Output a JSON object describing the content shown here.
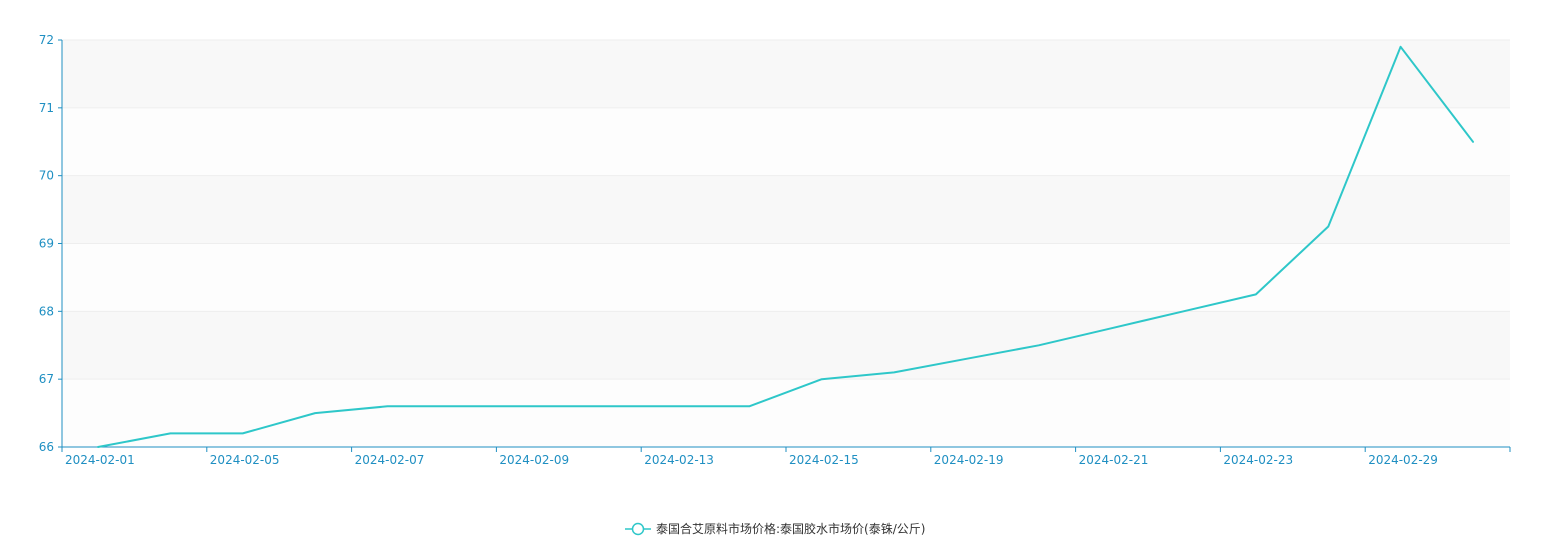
{
  "chart_data": {
    "type": "line",
    "title": "",
    "xlabel": "",
    "ylabel": "",
    "ylim": [
      66,
      72
    ],
    "y_ticks": [
      66,
      67,
      68,
      69,
      70,
      71,
      72
    ],
    "x_tick_labels": [
      "2024-02-01",
      "2024-02-05",
      "2024-02-07",
      "2024-02-09",
      "2024-02-13",
      "2024-02-15",
      "2024-02-19",
      "2024-02-21",
      "2024-02-23",
      "2024-02-29"
    ],
    "grid": "horizontal bands",
    "legend_position": "bottom-center",
    "colors": {
      "line": "#2ec7c9",
      "axis": "#1f8fc2",
      "band": "#f8f8f8",
      "grid": "#eeeeee"
    },
    "series": [
      {
        "name": "泰国合艾原料市场价格:泰国胶水市场价(泰铢/公斤)",
        "points": [
          {
            "x": "2024-02-01",
            "y": 66.0
          },
          {
            "x": "2024-02-02",
            "y": 66.2
          },
          {
            "x": "2024-02-05",
            "y": 66.2
          },
          {
            "x": "2024-02-06",
            "y": 66.5
          },
          {
            "x": "2024-02-07",
            "y": 66.6
          },
          {
            "x": "2024-02-08",
            "y": 66.6
          },
          {
            "x": "2024-02-09",
            "y": 66.6
          },
          {
            "x": "2024-02-12",
            "y": 66.6
          },
          {
            "x": "2024-02-13",
            "y": 66.6
          },
          {
            "x": "2024-02-14",
            "y": 66.6
          },
          {
            "x": "2024-02-15",
            "y": 67.0
          },
          {
            "x": "2024-02-16",
            "y": 67.1
          },
          {
            "x": "2024-02-19",
            "y": 67.3
          },
          {
            "x": "2024-02-20",
            "y": 67.5
          },
          {
            "x": "2024-02-21",
            "y": 67.75
          },
          {
            "x": "2024-02-22",
            "y": 68.0
          },
          {
            "x": "2024-02-23",
            "y": 68.25
          },
          {
            "x": "2024-02-26",
            "y": 69.25
          },
          {
            "x": "2024-02-29",
            "y": 71.9
          },
          {
            "x": "2024-03-01",
            "y": 70.5
          }
        ]
      }
    ]
  }
}
